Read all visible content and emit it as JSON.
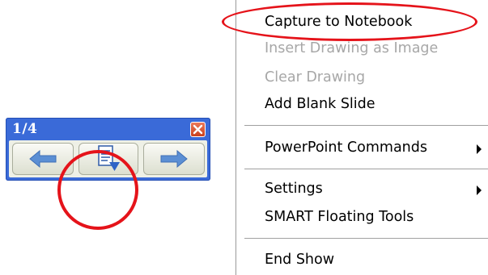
{
  "toolbar": {
    "page_indicator": "1/4",
    "buttons": [
      {
        "name": "previous-page",
        "icon": "arrow-left-icon"
      },
      {
        "name": "capture",
        "icon": "capture-to-notebook-icon"
      },
      {
        "name": "next-page",
        "icon": "arrow-right-icon"
      }
    ],
    "close_icon": "close-icon"
  },
  "menu": {
    "items": [
      {
        "label": "Capture to Notebook",
        "enabled": true,
        "submenu": false
      },
      {
        "label": "Insert Drawing as Image",
        "enabled": false,
        "submenu": false
      },
      {
        "label": "Clear Drawing",
        "enabled": false,
        "submenu": false
      },
      {
        "label": "Add Blank Slide",
        "enabled": true,
        "submenu": false
      },
      {
        "label": "PowerPoint Commands",
        "enabled": true,
        "submenu": true
      },
      {
        "label": "Settings",
        "enabled": true,
        "submenu": true
      },
      {
        "label": "SMART Floating Tools",
        "enabled": true,
        "submenu": false
      },
      {
        "label": "End Show",
        "enabled": true,
        "submenu": false
      }
    ]
  },
  "colors": {
    "titlebar": "#3a6ad8",
    "highlight": "#e5131a",
    "disabled_text": "#a7a7a7",
    "arrow_icon": "#5b8fd4"
  }
}
